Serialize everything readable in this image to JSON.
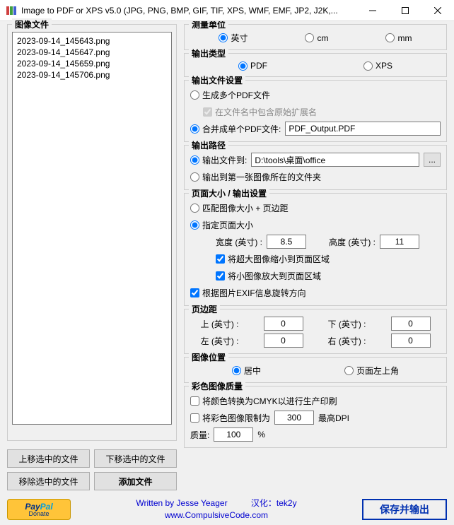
{
  "title": "Image to PDF or XPS  v5.0   (JPG, PNG, BMP, GIF, TIF, XPS, WMF, EMF, JP2, J2K,...",
  "left": {
    "legend": "图像文件",
    "files": [
      "2023-09-14_145643.png",
      "2023-09-14_145647.png",
      "2023-09-14_145659.png",
      "2023-09-14_145706.png"
    ],
    "btn_up": "上移选中的文件",
    "btn_down": "下移选中的文件",
    "btn_remove": "移除选中的文件",
    "btn_add": "添加文件"
  },
  "unit": {
    "legend": "测量单位",
    "inch": "英寸",
    "cm": "cm",
    "mm": "mm"
  },
  "outtype": {
    "legend": "输出类型",
    "pdf": "PDF",
    "xps": "XPS"
  },
  "outfile": {
    "legend": "输出文件设置",
    "multi": "生成多个PDF文件",
    "incext": "在文件名中包含原始扩展名",
    "merge": "合并成单个PDF文件:",
    "mergeval": "PDF_Output.PDF"
  },
  "outpath": {
    "legend": "输出路径",
    "to": "输出文件到:",
    "toval": "D:\\tools\\桌面\\office",
    "browse": "...",
    "first": "输出到第一张图像所在的文件夹"
  },
  "page": {
    "legend": "页面大小 / 输出设置",
    "match": "匹配图像大小 + 页边距",
    "specify": "指定页面大小",
    "wlabel": "宽度 (英寸) :",
    "wval": "8.5",
    "hlabel": "高度 (英寸) :",
    "hval": "11",
    "shrink": "将超大图像缩小到页面区域",
    "enlarge": "将小图像放大到页面区域",
    "exif": "根据图片EXIF信息旋转方向"
  },
  "margin": {
    "legend": "页边距",
    "top": "上 (英寸) :",
    "bottom": "下 (英寸) :",
    "left": "左 (英寸) :",
    "right": "右 (英寸) :",
    "v0": "0"
  },
  "pos": {
    "legend": "图像位置",
    "center": "居中",
    "topleft": "页面左上角"
  },
  "quality": {
    "legend": "彩色图像质量",
    "cmyk": "将颜色转换为CMYK以进行生产印刷",
    "limit": "将彩色图像限制为",
    "dpi": "300",
    "dpil": "最高DPI",
    "qlabel": "质量:",
    "qval": "100",
    "pct": "%"
  },
  "footer": {
    "written": "Written by Jesse Yeager",
    "web": "www.CompulsiveCode.com",
    "cn": "汉化：tek2y",
    "save": "保存并输出",
    "donate": "Donate"
  }
}
